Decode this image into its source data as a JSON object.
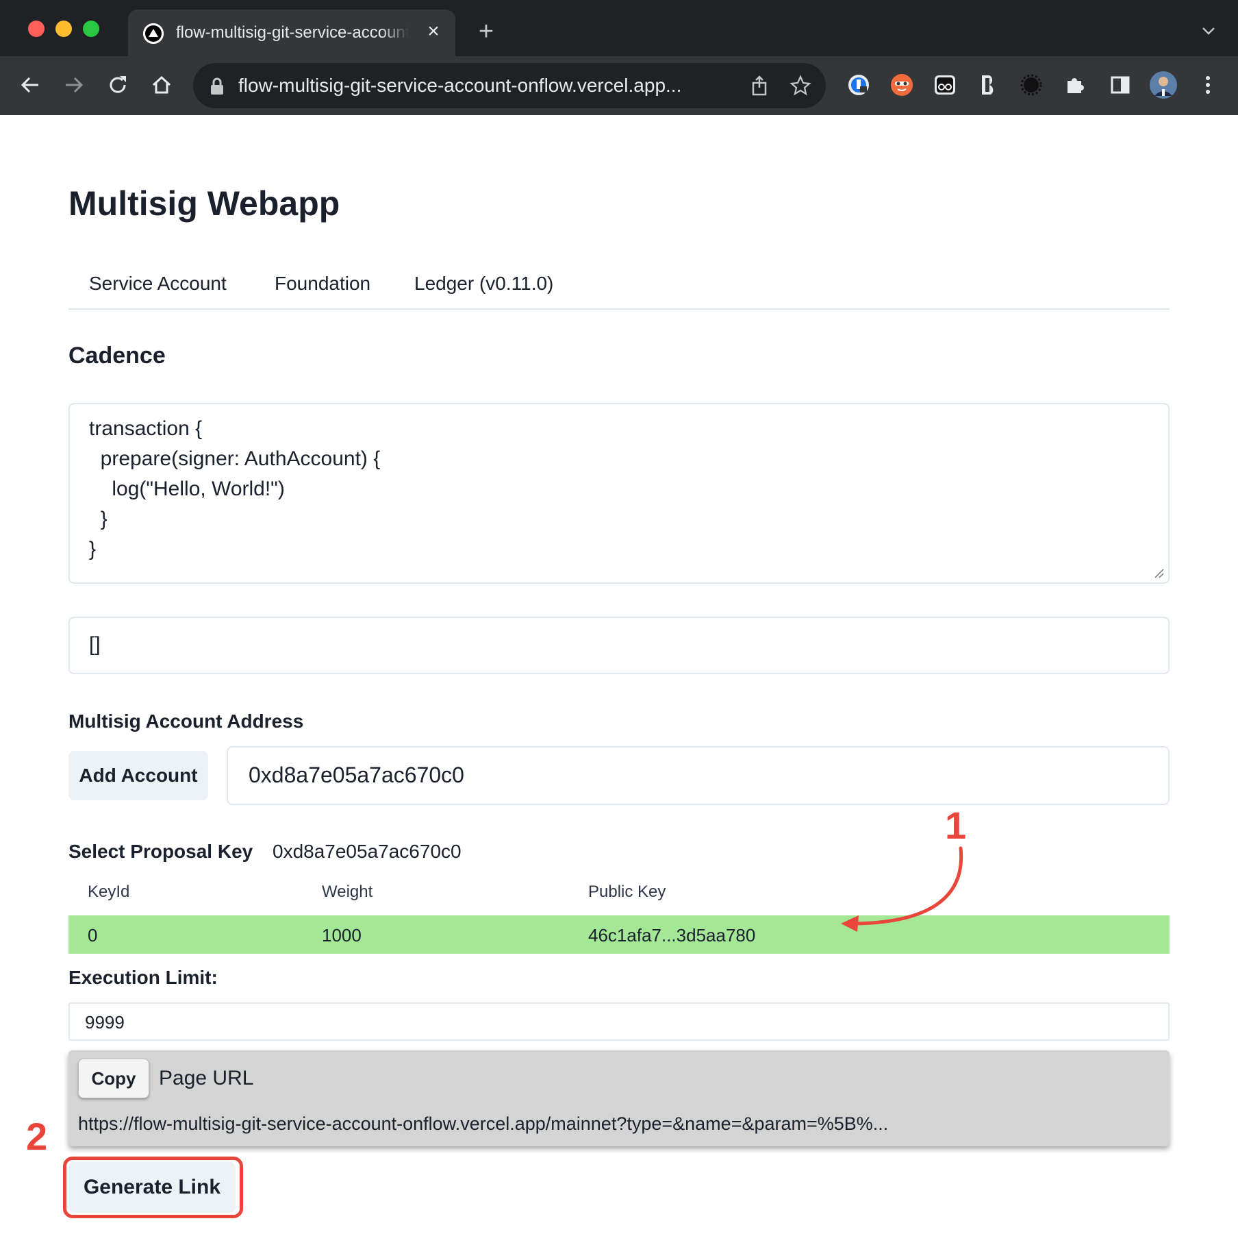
{
  "browser": {
    "tab_title": "flow-multisig-git-service-account-onflow.vercel.app",
    "url": "flow-multisig-git-service-account-onflow.vercel.app...",
    "colors": {
      "frame": "#202124",
      "toolbar": "#35363a"
    }
  },
  "page": {
    "title": "Multisig Webapp",
    "tabs": [
      {
        "label": "Service Account"
      },
      {
        "label": "Foundation"
      },
      {
        "label": "Ledger (v0.11.0)"
      }
    ],
    "cadence": {
      "heading": "Cadence",
      "code_lines": [
        "transaction {",
        "  prepare(signer: AuthAccount) {",
        "    log(\"Hello, World!\")",
        "  }",
        "}"
      ],
      "args_value": "[]"
    },
    "account": {
      "label": "Multisig Account Address",
      "add_button": "Add Account",
      "address_value": "0xd8a7e05a7ac670c0"
    },
    "proposal": {
      "label": "Select Proposal Key",
      "address": "0xd8a7e05a7ac670c0",
      "columns": [
        "KeyId",
        "Weight",
        "Public Key"
      ],
      "rows": [
        {
          "key_id": "0",
          "weight": "1000",
          "public_key": "46c1afa7...3d5aa780"
        }
      ],
      "selected_color": "#a4e897"
    },
    "execution": {
      "label": "Execution Limit:",
      "value": "9999"
    },
    "link_panel": {
      "copy_button": "Copy",
      "label": "Page URL",
      "url": "https://flow-multisig-git-service-account-onflow.vercel.app/mainnet?type=&name=&param=%5B%..."
    },
    "generate_button": "Generate Link"
  },
  "annotations": {
    "step1": "1",
    "step2": "2",
    "color": "#e8463a"
  }
}
